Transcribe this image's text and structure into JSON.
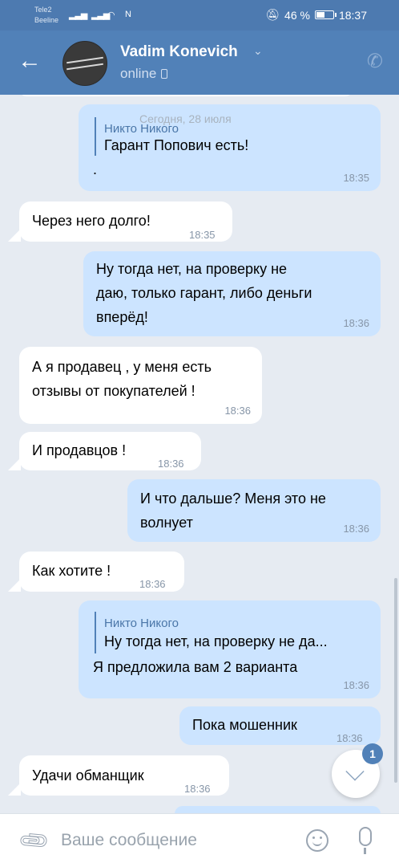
{
  "status_bar": {
    "carrier1": "Tele2",
    "carrier2": "Beeline",
    "battery": "46 %",
    "time": "18:37"
  },
  "header": {
    "contact_name": "Vadim Konevich",
    "status": "online",
    "icons": [
      "back-arrow-icon",
      "phone-call-icon",
      "chevron-down-icon"
    ]
  },
  "chat": {
    "date_divider": "Сегодня, 28 июля",
    "messages": [
      {
        "dir": "out",
        "reply_name": "Никто Никого",
        "reply_text": "Гарант Попович есть!",
        "text": ".",
        "time": "18:35"
      },
      {
        "dir": "in",
        "text": "Через него долго!",
        "time": "18:35"
      },
      {
        "dir": "out",
        "lines": [
          "Ну тогда нет, на проверку не",
          "даю, только гарант, либо деньги",
          "вперёд!"
        ],
        "time": "18:36"
      },
      {
        "dir": "in",
        "lines": [
          "А я продавец , у меня есть",
          "отзывы от покупателей !"
        ],
        "time": "18:36"
      },
      {
        "dir": "in",
        "text": "И продавцов !",
        "time": "18:36"
      },
      {
        "dir": "out",
        "lines": [
          "И что дальше? Меня это не",
          "волнует"
        ],
        "time": "18:36"
      },
      {
        "dir": "in",
        "text": "Как хотите !",
        "time": "18:36"
      },
      {
        "dir": "out",
        "reply_name": "Никто Никого",
        "reply_text": "Ну тогда нет, на проверку не да...",
        "text": "Я предложила вам 2 варианта",
        "time": "18:36"
      },
      {
        "dir": "out",
        "text": "Пока мошенник",
        "time": "18:36"
      },
      {
        "dir": "in",
        "text": "Удачи обманщик",
        "time": "18:36"
      }
    ],
    "unread_badge": "1"
  },
  "composer": {
    "placeholder": "Ваше сообщение",
    "icons": [
      "attach-icon",
      "emoji-icon",
      "microphone-icon"
    ]
  },
  "colors": {
    "header": "#5181b8",
    "outgoing_bubble": "#cce4ff",
    "incoming_bubble": "#ffffff",
    "background": "#e6ebf2"
  }
}
